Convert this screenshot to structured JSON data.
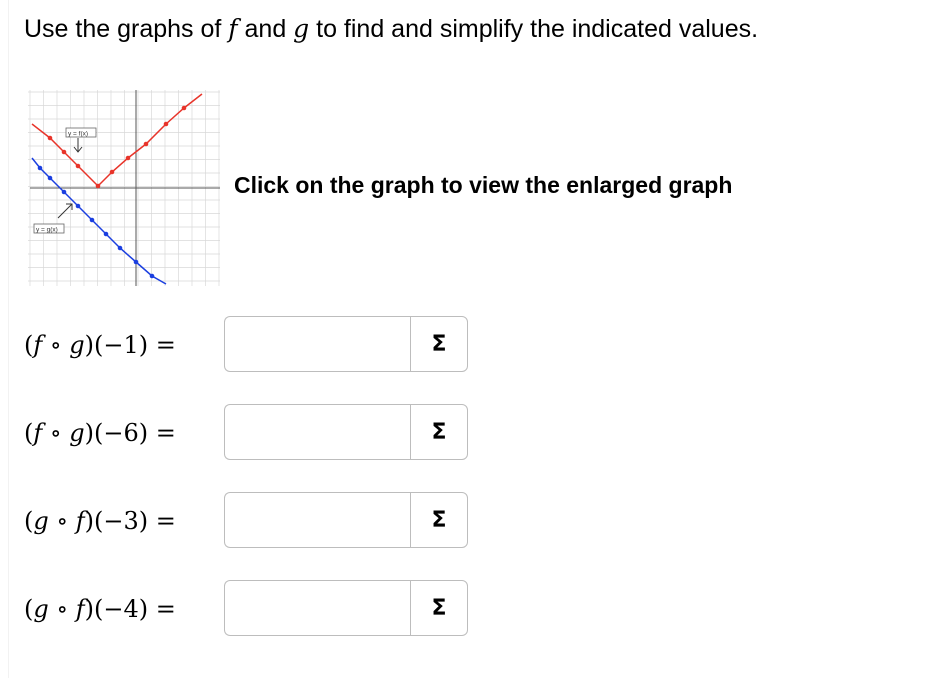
{
  "instruction": {
    "part1": "Use the graphs of ",
    "f": "f",
    "part2": " and ",
    "g": "g",
    "part3": " to find and simplify the indicated values."
  },
  "graph": {
    "label_f": "y = f(x)",
    "label_g": "y = g(x)",
    "color_f": "#e8342a",
    "color_g": "#1b3fe0"
  },
  "click_text": "Click on the graph to view the enlarged graph",
  "questions": [
    {
      "outer": "f",
      "inner": "g",
      "arg": "(−1)",
      "value": "",
      "sigma": "Σ"
    },
    {
      "outer": "f",
      "inner": "g",
      "arg": "(−6)",
      "value": "",
      "sigma": "Σ"
    },
    {
      "outer": "g",
      "inner": "f",
      "arg": "(−3)",
      "value": "",
      "sigma": "Σ"
    },
    {
      "outer": "g",
      "inner": "f",
      "arg": "(−4)",
      "value": "",
      "sigma": "Σ"
    }
  ]
}
